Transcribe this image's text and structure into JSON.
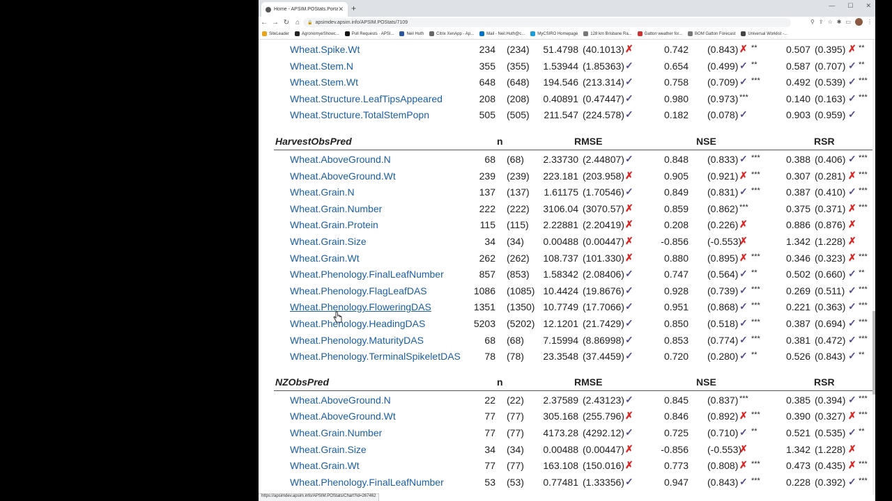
{
  "browser": {
    "tab_title": "Home - APSIM.POStats.Portal",
    "url": "apsimdev.apsim.info/APSIM.POStats/7109",
    "status_url": "https://apsimdev.apsim.info/APSIM.POStats/Chart?id=267462"
  },
  "bookmarks": [
    {
      "label": "SiteLeader",
      "color": "#e8a317"
    },
    {
      "label": "AgronomyeShowc...",
      "color": "#222222"
    },
    {
      "label": "Pull Requests · APSI...",
      "color": "#111111"
    },
    {
      "label": "Neil Huth",
      "color": "#2b579a"
    },
    {
      "label": "Citrix XenApp - Ap...",
      "color": "#666666"
    },
    {
      "label": "Mail - Neil.Huth@c...",
      "color": "#0072c6"
    },
    {
      "label": "MyCSIRO Homepage",
      "color": "#1b9bd7"
    },
    {
      "label": "128 km Brisbane Ra...",
      "color": "#777777"
    },
    {
      "label": "Gatton weather for...",
      "color": "#cc3333"
    },
    {
      "label": "BOM Gatton Forecast",
      "color": "#777777"
    },
    {
      "label": "Universal Worklist -...",
      "color": "#444444"
    }
  ],
  "headers": {
    "n": "n",
    "rmse": "RMSE",
    "nse": "NSE",
    "rsr": "RSR"
  },
  "top_rows": [
    {
      "name": "Wheat.Spike.Wt",
      "n": "234",
      "np": "(234)",
      "rmse": "51.4798",
      "rmsep": "(40.1013)",
      "rmse_ok": false,
      "nse": "0.742",
      "nsep": "(0.843)",
      "nse_ok": false,
      "nse_stars": "**",
      "rsr": "0.507",
      "rsrp": "(0.395)",
      "rsr_ok": false,
      "rsr_stars": "**"
    },
    {
      "name": "Wheat.Stem.N",
      "n": "355",
      "np": "(355)",
      "rmse": "1.53944",
      "rmsep": "(1.85363)",
      "rmse_ok": true,
      "nse": "0.654",
      "nsep": "(0.499)",
      "nse_ok": true,
      "nse_stars": "**",
      "rsr": "0.587",
      "rsrp": "(0.707)",
      "rsr_ok": true,
      "rsr_stars": "**"
    },
    {
      "name": "Wheat.Stem.Wt",
      "n": "648",
      "np": "(648)",
      "rmse": "194.546",
      "rmsep": "(213.314)",
      "rmse_ok": true,
      "nse": "0.758",
      "nsep": "(0.709)",
      "nse_ok": true,
      "nse_stars": "***",
      "rsr": "0.492",
      "rsrp": "(0.539)",
      "rsr_ok": true,
      "rsr_stars": "***"
    },
    {
      "name": "Wheat.Structure.LeafTipsAppeared",
      "n": "208",
      "np": "(208)",
      "rmse": "0.40891",
      "rmsep": "(0.47447)",
      "rmse_ok": true,
      "nse": "0.980",
      "nsep": "(0.973)",
      "nse_ok": null,
      "nse_stars": "***",
      "rsr": "0.140",
      "rsrp": "(0.163)",
      "rsr_ok": true,
      "rsr_stars": "***"
    },
    {
      "name": "Wheat.Structure.TotalStemPopn",
      "n": "505",
      "np": "(505)",
      "rmse": "211.547",
      "rmsep": "(224.578)",
      "rmse_ok": true,
      "nse": "0.182",
      "nsep": "(0.078)",
      "nse_ok": true,
      "nse_stars": "",
      "rsr": "0.903",
      "rsrp": "(0.959)",
      "rsr_ok": true,
      "rsr_stars": ""
    }
  ],
  "sections": [
    {
      "title": "HarvestObsPred",
      "rows": [
        {
          "name": "Wheat.AboveGround.N",
          "n": "68",
          "np": "(68)",
          "rmse": "2.33730",
          "rmsep": "(2.44807)",
          "rmse_ok": true,
          "nse": "0.848",
          "nsep": "(0.833)",
          "nse_ok": true,
          "nse_stars": "***",
          "rsr": "0.388",
          "rsrp": "(0.406)",
          "rsr_ok": true,
          "rsr_stars": "***"
        },
        {
          "name": "Wheat.AboveGround.Wt",
          "n": "239",
          "np": "(239)",
          "rmse": "223.181",
          "rmsep": "(203.958)",
          "rmse_ok": false,
          "nse": "0.905",
          "nsep": "(0.921)",
          "nse_ok": false,
          "nse_stars": "***",
          "rsr": "0.307",
          "rsrp": "(0.281)",
          "rsr_ok": false,
          "rsr_stars": "***"
        },
        {
          "name": "Wheat.Grain.N",
          "n": "137",
          "np": "(137)",
          "rmse": "1.61175",
          "rmsep": "(1.70546)",
          "rmse_ok": true,
          "nse": "0.849",
          "nsep": "(0.831)",
          "nse_ok": true,
          "nse_stars": "***",
          "rsr": "0.387",
          "rsrp": "(0.410)",
          "rsr_ok": true,
          "rsr_stars": "***"
        },
        {
          "name": "Wheat.Grain.Number",
          "n": "222",
          "np": "(222)",
          "rmse": "3106.04",
          "rmsep": "(3070.57)",
          "rmse_ok": false,
          "nse": "0.859",
          "nsep": "(0.862)",
          "nse_ok": null,
          "nse_stars": "***",
          "rsr": "0.375",
          "rsrp": "(0.371)",
          "rsr_ok": false,
          "rsr_stars": "***"
        },
        {
          "name": "Wheat.Grain.Protein",
          "n": "115",
          "np": "(115)",
          "rmse": "2.22881",
          "rmsep": "(2.20419)",
          "rmse_ok": false,
          "nse": "0.208",
          "nsep": "(0.226)",
          "nse_ok": false,
          "nse_stars": "",
          "rsr": "0.886",
          "rsrp": "(0.876)",
          "rsr_ok": false,
          "rsr_stars": ""
        },
        {
          "name": "Wheat.Grain.Size",
          "n": "34",
          "np": "(34)",
          "rmse": "0.00488",
          "rmsep": "(0.00447)",
          "rmse_ok": false,
          "nse": "-0.856",
          "nsep": "(-0.553)",
          "nse_ok": false,
          "nse_stars": "",
          "rsr": "1.342",
          "rsrp": "(1.228)",
          "rsr_ok": false,
          "rsr_stars": ""
        },
        {
          "name": "Wheat.Grain.Wt",
          "n": "262",
          "np": "(262)",
          "rmse": "108.737",
          "rmsep": "(101.330)",
          "rmse_ok": false,
          "nse": "0.880",
          "nsep": "(0.895)",
          "nse_ok": false,
          "nse_stars": "***",
          "rsr": "0.346",
          "rsrp": "(0.323)",
          "rsr_ok": false,
          "rsr_stars": "***"
        },
        {
          "name": "Wheat.Phenology.FinalLeafNumber",
          "n": "857",
          "np": "(853)",
          "rmse": "1.58342",
          "rmsep": "(2.08406)",
          "rmse_ok": true,
          "nse": "0.747",
          "nsep": "(0.564)",
          "nse_ok": true,
          "nse_stars": "**",
          "rsr": "0.502",
          "rsrp": "(0.660)",
          "rsr_ok": true,
          "rsr_stars": "**"
        },
        {
          "name": "Wheat.Phenology.FlagLeafDAS",
          "n": "1086",
          "np": "(1085)",
          "rmse": "10.4424",
          "rmsep": "(19.8676)",
          "rmse_ok": true,
          "nse": "0.928",
          "nsep": "(0.739)",
          "nse_ok": true,
          "nse_stars": "***",
          "rsr": "0.269",
          "rsrp": "(0.511)",
          "rsr_ok": true,
          "rsr_stars": "***"
        },
        {
          "name": "Wheat.Phenology.FloweringDAS",
          "n": "1351",
          "np": "(1350)",
          "rmse": "10.7749",
          "rmsep": "(17.7066)",
          "rmse_ok": true,
          "nse": "0.951",
          "nsep": "(0.868)",
          "nse_ok": true,
          "nse_stars": "***",
          "rsr": "0.221",
          "rsrp": "(0.363)",
          "rsr_ok": true,
          "rsr_stars": "***",
          "hover": true
        },
        {
          "name": "Wheat.Phenology.HeadingDAS",
          "n": "5203",
          "np": "(5202)",
          "rmse": "12.1201",
          "rmsep": "(21.7429)",
          "rmse_ok": true,
          "nse": "0.850",
          "nsep": "(0.518)",
          "nse_ok": true,
          "nse_stars": "***",
          "rsr": "0.387",
          "rsrp": "(0.694)",
          "rsr_ok": true,
          "rsr_stars": "***"
        },
        {
          "name": "Wheat.Phenology.MaturityDAS",
          "n": "68",
          "np": "(68)",
          "rmse": "7.15994",
          "rmsep": "(8.86998)",
          "rmse_ok": true,
          "nse": "0.853",
          "nsep": "(0.774)",
          "nse_ok": true,
          "nse_stars": "***",
          "rsr": "0.381",
          "rsrp": "(0.472)",
          "rsr_ok": true,
          "rsr_stars": "***"
        },
        {
          "name": "Wheat.Phenology.TerminalSpikeletDAS",
          "n": "78",
          "np": "(78)",
          "rmse": "23.3548",
          "rmsep": "(37.4459)",
          "rmse_ok": true,
          "nse": "0.720",
          "nsep": "(0.280)",
          "nse_ok": true,
          "nse_stars": "**",
          "rsr": "0.526",
          "rsrp": "(0.843)",
          "rsr_ok": true,
          "rsr_stars": "**"
        }
      ]
    },
    {
      "title": "NZObsPred",
      "rows": [
        {
          "name": "Wheat.AboveGround.N",
          "n": "22",
          "np": "(22)",
          "rmse": "2.37589",
          "rmsep": "(2.43123)",
          "rmse_ok": true,
          "nse": "0.845",
          "nsep": "(0.837)",
          "nse_ok": null,
          "nse_stars": "***",
          "rsr": "0.385",
          "rsrp": "(0.394)",
          "rsr_ok": true,
          "rsr_stars": "***"
        },
        {
          "name": "Wheat.AboveGround.Wt",
          "n": "77",
          "np": "(77)",
          "rmse": "305.168",
          "rmsep": "(255.796)",
          "rmse_ok": false,
          "nse": "0.846",
          "nsep": "(0.892)",
          "nse_ok": false,
          "nse_stars": "***",
          "rsr": "0.390",
          "rsrp": "(0.327)",
          "rsr_ok": false,
          "rsr_stars": "***"
        },
        {
          "name": "Wheat.Grain.Number",
          "n": "77",
          "np": "(77)",
          "rmse": "4173.28",
          "rmsep": "(4292.12)",
          "rmse_ok": true,
          "nse": "0.725",
          "nsep": "(0.710)",
          "nse_ok": true,
          "nse_stars": "**",
          "rsr": "0.521",
          "rsrp": "(0.535)",
          "rsr_ok": true,
          "rsr_stars": "**"
        },
        {
          "name": "Wheat.Grain.Size",
          "n": "34",
          "np": "(34)",
          "rmse": "0.00488",
          "rmsep": "(0.00447)",
          "rmse_ok": false,
          "nse": "-0.856",
          "nsep": "(-0.553)",
          "nse_ok": false,
          "nse_stars": "",
          "rsr": "1.342",
          "rsrp": "(1.228)",
          "rsr_ok": false,
          "rsr_stars": ""
        },
        {
          "name": "Wheat.Grain.Wt",
          "n": "77",
          "np": "(77)",
          "rmse": "163.108",
          "rmsep": "(150.016)",
          "rmse_ok": false,
          "nse": "0.773",
          "nsep": "(0.808)",
          "nse_ok": false,
          "nse_stars": "***",
          "rsr": "0.473",
          "rsrp": "(0.435)",
          "rsr_ok": false,
          "rsr_stars": "***"
        },
        {
          "name": "Wheat.Phenology.FinalLeafNumber",
          "n": "53",
          "np": "(53)",
          "rmse": "0.77481",
          "rmsep": "(1.33356)",
          "rmse_ok": true,
          "nse": "0.947",
          "nsep": "(0.843)",
          "nse_ok": true,
          "nse_stars": "***",
          "rsr": "0.228",
          "rsrp": "(0.392)",
          "rsr_ok": true,
          "rsr_stars": "***"
        }
      ]
    }
  ]
}
